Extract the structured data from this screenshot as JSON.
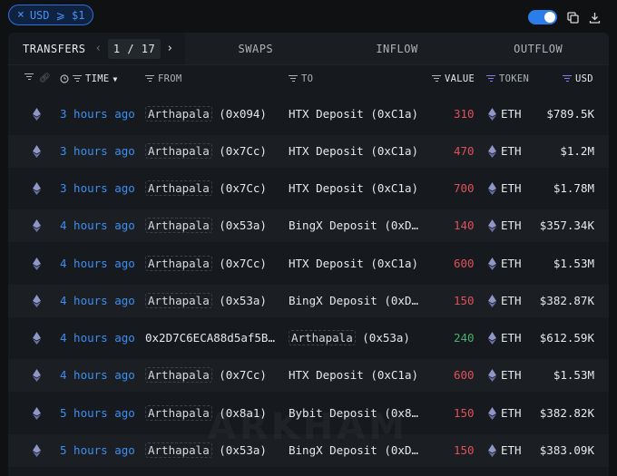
{
  "filter_chip": {
    "close": "×",
    "label": "USD ⩾ $1"
  },
  "tabs": {
    "transfers": "TRANSFERS",
    "page_current": "1",
    "page_sep": "/",
    "page_total": "17",
    "swaps": "SWAPS",
    "inflow": "INFLOW",
    "outflow": "OUTFLOW"
  },
  "columns": {
    "time": "TIME",
    "from": "FROM",
    "to": "TO",
    "value": "VALUE",
    "token": "TOKEN",
    "usd": "USD"
  },
  "watermark": "ARKHAM",
  "rows": [
    {
      "time": "3 hours ago",
      "from_name": "Arthapala",
      "from_addr": "(0x094)",
      "to_name": "HTX Deposit",
      "to_addr": "(0xC1a)",
      "value": "310",
      "token": "ETH",
      "usd": "$789.5K"
    },
    {
      "time": "3 hours ago",
      "from_name": "Arthapala",
      "from_addr": "(0x7Cc)",
      "to_name": "HTX Deposit",
      "to_addr": "(0xC1a)",
      "value": "470",
      "token": "ETH",
      "usd": "$1.2M"
    },
    {
      "time": "3 hours ago",
      "from_name": "Arthapala",
      "from_addr": "(0x7Cc)",
      "to_name": "HTX Deposit",
      "to_addr": "(0xC1a)",
      "value": "700",
      "token": "ETH",
      "usd": "$1.78M"
    },
    {
      "time": "4 hours ago",
      "from_name": "Arthapala",
      "from_addr": "(0x53a)",
      "to_name": "BingX Deposit",
      "to_addr": "(0xD…",
      "value": "140",
      "token": "ETH",
      "usd": "$357.34K"
    },
    {
      "time": "4 hours ago",
      "from_name": "Arthapala",
      "from_addr": "(0x7Cc)",
      "to_name": "HTX Deposit",
      "to_addr": "(0xC1a)",
      "value": "600",
      "token": "ETH",
      "usd": "$1.53M"
    },
    {
      "time": "4 hours ago",
      "from_name": "Arthapala",
      "from_addr": "(0x53a)",
      "to_name": "BingX Deposit",
      "to_addr": "(0xD…",
      "value": "150",
      "token": "ETH",
      "usd": "$382.87K"
    },
    {
      "time": "4 hours ago",
      "from_plain": "0x2D7C6ECA88d5af5B…",
      "to_name": "Arthapala",
      "to_addr": "(0x53a)",
      "value": "240",
      "token": "ETH",
      "usd": "$612.59K",
      "inflow": true
    },
    {
      "time": "4 hours ago",
      "from_name": "Arthapala",
      "from_addr": "(0x7Cc)",
      "to_name": "HTX Deposit",
      "to_addr": "(0xC1a)",
      "value": "600",
      "token": "ETH",
      "usd": "$1.53M"
    },
    {
      "time": "5 hours ago",
      "from_name": "Arthapala",
      "from_addr": "(0x8a1)",
      "to_name": "Bybit Deposit",
      "to_addr": "(0x8…",
      "value": "150",
      "token": "ETH",
      "usd": "$382.82K"
    },
    {
      "time": "5 hours ago",
      "from_name": "Arthapala",
      "from_addr": "(0x53a)",
      "to_name": "BingX Deposit",
      "to_addr": "(0xD…",
      "value": "150",
      "token": "ETH",
      "usd": "$383.09K"
    }
  ]
}
